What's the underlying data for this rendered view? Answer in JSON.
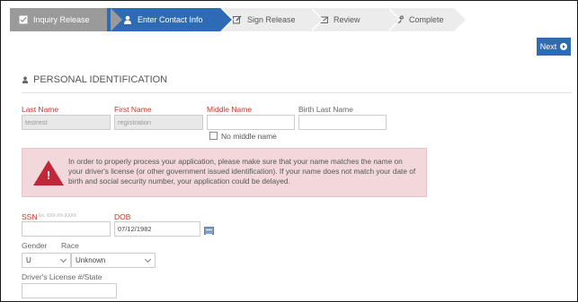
{
  "steps": [
    {
      "label": "Inquiry Release",
      "icon": "check-square-icon",
      "state": "done"
    },
    {
      "label": "Enter Contact Info",
      "icon": "user-icon",
      "state": "active"
    },
    {
      "label": "Sign Release",
      "icon": "edit-icon",
      "state": "pending"
    },
    {
      "label": "Review",
      "icon": "envelope-icon",
      "state": "pending"
    },
    {
      "label": "Complete",
      "icon": "cogs-icon",
      "state": "pending"
    }
  ],
  "next_label": "Next",
  "section_title": "PERSONAL IDENTIFICATION",
  "fields": {
    "last_name": {
      "label": "Last Name",
      "value": "testrest"
    },
    "first_name": {
      "label": "First Name",
      "value": "registration"
    },
    "middle_name": {
      "label": "Middle Name",
      "value": ""
    },
    "birth_last_name": {
      "label": "Birth Last Name",
      "value": ""
    },
    "no_middle_name": {
      "label": "No middle name",
      "checked": false
    },
    "ssn": {
      "label": "SSN",
      "hint": "Ex: XXX-XX-XXXX",
      "value": ""
    },
    "dob": {
      "label": "DOB",
      "value": "07/12/1982"
    },
    "gender": {
      "label": "Gender",
      "value": "U"
    },
    "race": {
      "label": "Race",
      "value": "Unknown"
    },
    "drivers_license": {
      "label": "Driver's License #/State",
      "value": ""
    }
  },
  "alert_message": "In order to properly process your application, please make sure that your name matches the name on your driver's license (or other government issued identification). If your name does not match your date of birth and social security number, your application could be delayed.",
  "colors": {
    "accent": "#2d6cb5",
    "required": "#c0392b",
    "alert_bg": "#f2d8da",
    "alert_icon": "#c0283a"
  }
}
